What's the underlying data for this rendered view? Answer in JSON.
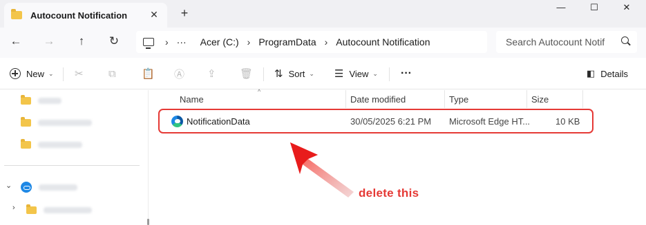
{
  "window": {
    "tab_title": "Autocount Notification",
    "tab_close": "✕",
    "new_tab": "+",
    "minimize": "—",
    "maximize": "☐",
    "close": "✕"
  },
  "address": {
    "back": "←",
    "forward": "→",
    "up": "↑",
    "refresh": "↻",
    "more": "···",
    "crumbs": [
      "Acer (C:)",
      "ProgramData",
      "Autocount Notification"
    ],
    "separator": "›",
    "search_placeholder": "Search Autocount Notif"
  },
  "commands": {
    "new_label": "New",
    "sort_label": "Sort",
    "view_label": "View",
    "more": "···",
    "details_label": "Details",
    "chevron": "⌄"
  },
  "columns": {
    "name": "Name",
    "date_modified": "Date modified",
    "type": "Type",
    "size": "Size"
  },
  "files": [
    {
      "name": "NotificationData",
      "date_modified": "30/05/2025 6:21 PM",
      "type": "Microsoft Edge HT...",
      "size": "10 KB",
      "icon": "edge-icon"
    }
  ],
  "sidebar": {
    "expand_open": "⌄",
    "expand_closed": "›"
  },
  "annotation": {
    "text": "delete this",
    "color": "#e53935"
  },
  "colors": {
    "accent_red": "#e53935",
    "folder_yellow": "#f3c54a",
    "titlebar_bg": "#f0f0f3"
  }
}
